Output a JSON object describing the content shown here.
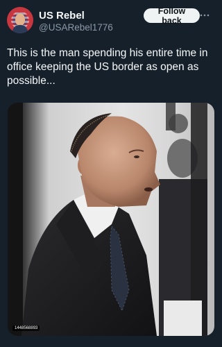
{
  "account": {
    "display_name": "US Rebel",
    "handle": "@USARebel1776"
  },
  "actions": {
    "follow_label": "Follow back"
  },
  "tweet": {
    "text": "This is the man spending his entire time in office keeping the US border as open as possible..."
  },
  "media": {
    "photo_id": "1448568893"
  },
  "icons": {
    "more": "more-options-icon"
  },
  "colors": {
    "background": "#15202b",
    "text": "#f7f9f9",
    "secondary_text": "#8b98a5",
    "button_bg": "#eff3f4"
  }
}
